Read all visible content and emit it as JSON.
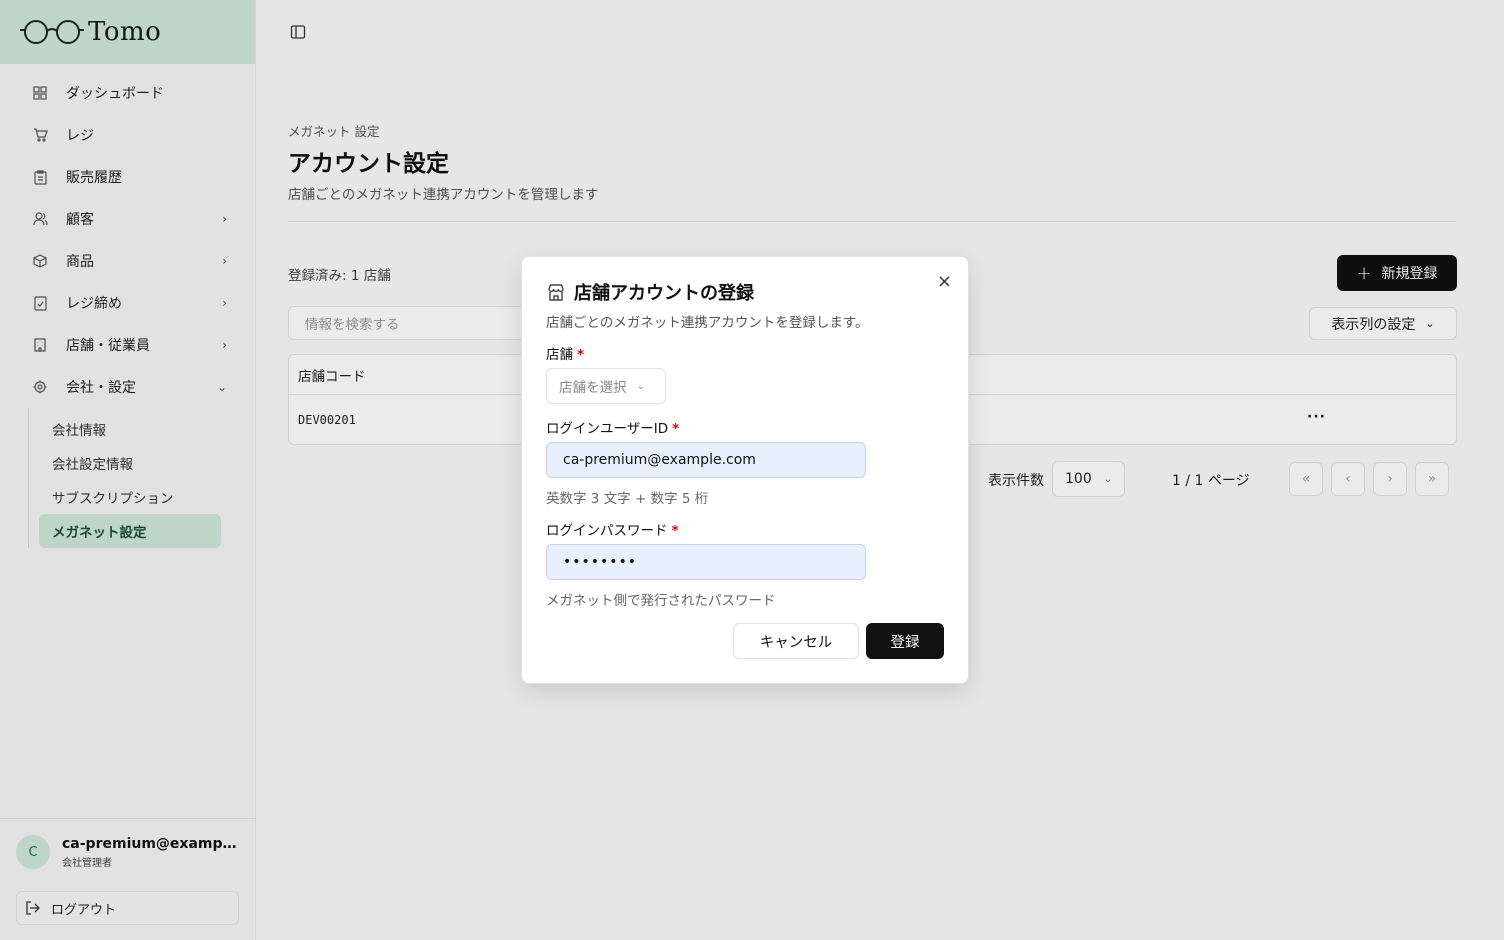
{
  "app": {
    "logo_text": "Tomo"
  },
  "sidebar": {
    "items": [
      {
        "label": "ダッシュボード",
        "icon": "grid-icon"
      },
      {
        "label": "レジ",
        "icon": "cart-icon"
      },
      {
        "label": "販売履歴",
        "icon": "clipboard-icon"
      },
      {
        "label": "顧客",
        "icon": "users-icon",
        "chevron": "right"
      },
      {
        "label": "商品",
        "icon": "box-icon",
        "chevron": "right"
      },
      {
        "label": "レジ締め",
        "icon": "checklist-icon",
        "chevron": "right"
      },
      {
        "label": "店舗・従業員",
        "icon": "building-icon",
        "chevron": "right"
      },
      {
        "label": "会社・設定",
        "icon": "gear-icon",
        "chevron": "down"
      }
    ],
    "sub_items": [
      {
        "label": "会社情報"
      },
      {
        "label": "会社設定情報"
      },
      {
        "label": "サブスクリプション"
      },
      {
        "label": "メガネット設定",
        "active": true
      }
    ],
    "user": {
      "initial": "C",
      "email": "ca-premium@example.com",
      "role": "会社管理者"
    },
    "logout_label": "ログアウト"
  },
  "page": {
    "breadcrumb": "メガネット 設定",
    "title": "アカウント設定",
    "description": "店舗ごとのメガネット連携アカウントを管理します",
    "count_label": "登録済み: 1 店舗",
    "new_button": "新規登録",
    "search_placeholder": "情報を検索する",
    "columns_button": "表示列の設定",
    "table": {
      "headers": [
        "店舗コード"
      ],
      "rows": [
        {
          "code": "DEV00201",
          "more": "···"
        }
      ]
    },
    "pagination": {
      "per_page_label": "表示件数",
      "per_page_value": "100",
      "page_info": "1 / 1 ページ",
      "first": "«",
      "prev": "‹",
      "next": "›",
      "last": "»"
    }
  },
  "dialog": {
    "title": "店舗アカウントの登録",
    "description": "店舗ごとのメガネット連携アカウントを登録します。",
    "store_label": "店舗",
    "store_placeholder": "店舗を選択",
    "login_id_label": "ログインユーザーID",
    "login_id_value": "ca-premium@example.com",
    "login_id_hint": "英数字 3 文字 + 数字 5 桁",
    "password_label": "ログインパスワード",
    "password_value": "••••••••",
    "password_hint": "メガネット側で発行されたパスワード",
    "required_mark": "*",
    "cancel": "キャンセル",
    "submit": "登録",
    "close": "×"
  }
}
